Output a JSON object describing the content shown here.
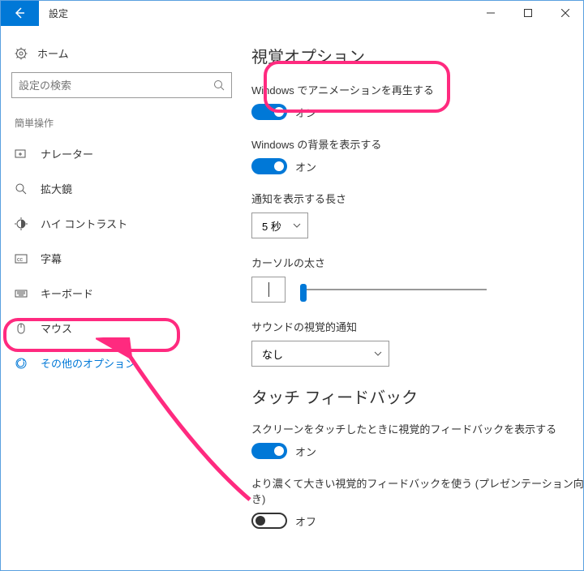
{
  "window": {
    "title": "設定"
  },
  "sidebar": {
    "home": "ホーム",
    "search_placeholder": "設定の検索",
    "section": "簡単操作",
    "items": [
      {
        "label": "ナレーター"
      },
      {
        "label": "拡大鏡"
      },
      {
        "label": "ハイ コントラスト"
      },
      {
        "label": "字幕"
      },
      {
        "label": "キーボード"
      },
      {
        "label": "マウス"
      },
      {
        "label": "その他のオプション"
      }
    ]
  },
  "main": {
    "heading1": "視覚オプション",
    "anim": {
      "label": "Windows でアニメーションを再生する",
      "state": "オン"
    },
    "bg": {
      "label": "Windows の背景を表示する",
      "state": "オン"
    },
    "notif_duration": {
      "label": "通知を表示する長さ",
      "value": "5 秒"
    },
    "cursor": {
      "label": "カーソルの太さ"
    },
    "sound_visual": {
      "label": "サウンドの視覚的通知",
      "value": "なし"
    },
    "heading2": "タッチ フィードバック",
    "touch_visual": {
      "label": "スクリーンをタッチしたときに視覚的フィードバックを表示する",
      "state": "オン"
    },
    "touch_dark": {
      "label": "より濃くて大きい視覚的フィードバックを使う (プレゼンテーション向き)",
      "state": "オフ"
    }
  }
}
